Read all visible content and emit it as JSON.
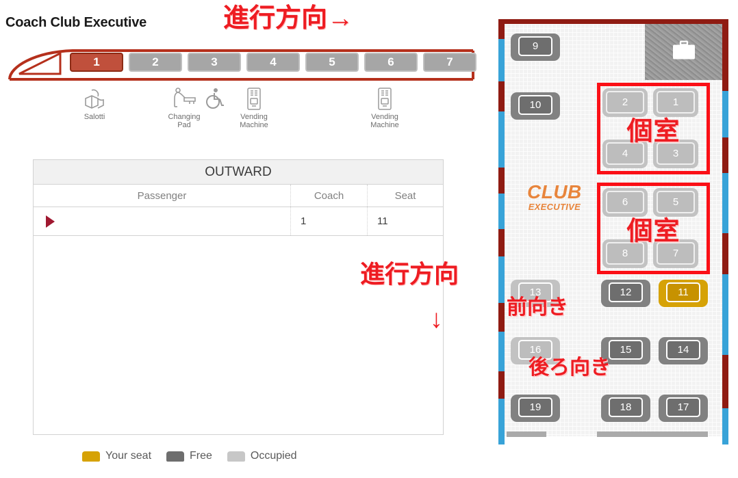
{
  "header": {
    "title": "Coach Club Executive",
    "direction_note": "進行方向→"
  },
  "train": {
    "coaches": [
      {
        "label": "1",
        "selected": true
      },
      {
        "label": "2",
        "selected": false
      },
      {
        "label": "3",
        "selected": false
      },
      {
        "label": "4",
        "selected": false
      },
      {
        "label": "5",
        "selected": false
      },
      {
        "label": "6",
        "selected": false
      },
      {
        "label": "7",
        "selected": false
      }
    ],
    "amenities": [
      {
        "icon": "lounge-seat-icon",
        "label": "Salotti"
      },
      {
        "icon": "changing-pad-icon",
        "label": "Changing\nPad"
      },
      {
        "icon": "wheelchair-icon",
        "label": ""
      },
      {
        "icon": "vending-machine-icon",
        "label": "Vending\nMachine"
      },
      {
        "icon": "vending-machine-icon",
        "label": "Vending\nMachine"
      }
    ],
    "amenity_labels": {
      "salotti": "Salotti",
      "changing_pad_line1": "Changing",
      "changing_pad_line2": "Pad",
      "vending_line1": "Vending",
      "vending_line2": "Machine"
    }
  },
  "table": {
    "title": "OUTWARD",
    "columns": [
      "Passenger",
      "Coach",
      "Seat"
    ],
    "rows": [
      {
        "passenger": "",
        "coach": "1",
        "seat": "11"
      }
    ]
  },
  "mid_annotation": {
    "text": "進行方向",
    "arrow": "↓"
  },
  "legend": {
    "items": [
      {
        "label": "Your seat",
        "color": "#d6a206"
      },
      {
        "label": "Free",
        "color": "#6e6e6e"
      },
      {
        "label": "Occupied",
        "color": "#c7c7c7"
      }
    ]
  },
  "seatmap": {
    "logo_line1": "CLUB",
    "logo_line2": "EXECUTIVE",
    "luggage_icon": "suitcase-icon",
    "compartments": [
      {
        "label": "個室",
        "seats": [
          "2",
          "1",
          "4",
          "3"
        ]
      },
      {
        "label": "個室",
        "seats": [
          "6",
          "5",
          "8",
          "7"
        ]
      }
    ],
    "annotations": [
      {
        "text": "前向き"
      },
      {
        "text": "後ろ向き"
      }
    ],
    "seats": [
      {
        "number": "9",
        "state": "free"
      },
      {
        "number": "10",
        "state": "free"
      },
      {
        "number": "1",
        "state": "occupied"
      },
      {
        "number": "2",
        "state": "occupied"
      },
      {
        "number": "3",
        "state": "occupied"
      },
      {
        "number": "4",
        "state": "occupied"
      },
      {
        "number": "5",
        "state": "occupied"
      },
      {
        "number": "6",
        "state": "occupied"
      },
      {
        "number": "7",
        "state": "occupied"
      },
      {
        "number": "8",
        "state": "occupied"
      },
      {
        "number": "11",
        "state": "yours"
      },
      {
        "number": "12",
        "state": "free"
      },
      {
        "number": "13",
        "state": "occupied"
      },
      {
        "number": "14",
        "state": "free"
      },
      {
        "number": "15",
        "state": "free"
      },
      {
        "number": "16",
        "state": "occupied"
      },
      {
        "number": "17",
        "state": "free"
      },
      {
        "number": "18",
        "state": "free"
      },
      {
        "number": "19",
        "state": "free"
      }
    ]
  },
  "colors": {
    "accent_red": "#ee1c22",
    "train_outline": "#b5301c",
    "selected_coach": "#c0503c",
    "your_seat": "#d6a206",
    "free_seat": "#6e6e6e",
    "occupied_seat": "#c7c7c7",
    "club_orange": "#e8853c"
  }
}
